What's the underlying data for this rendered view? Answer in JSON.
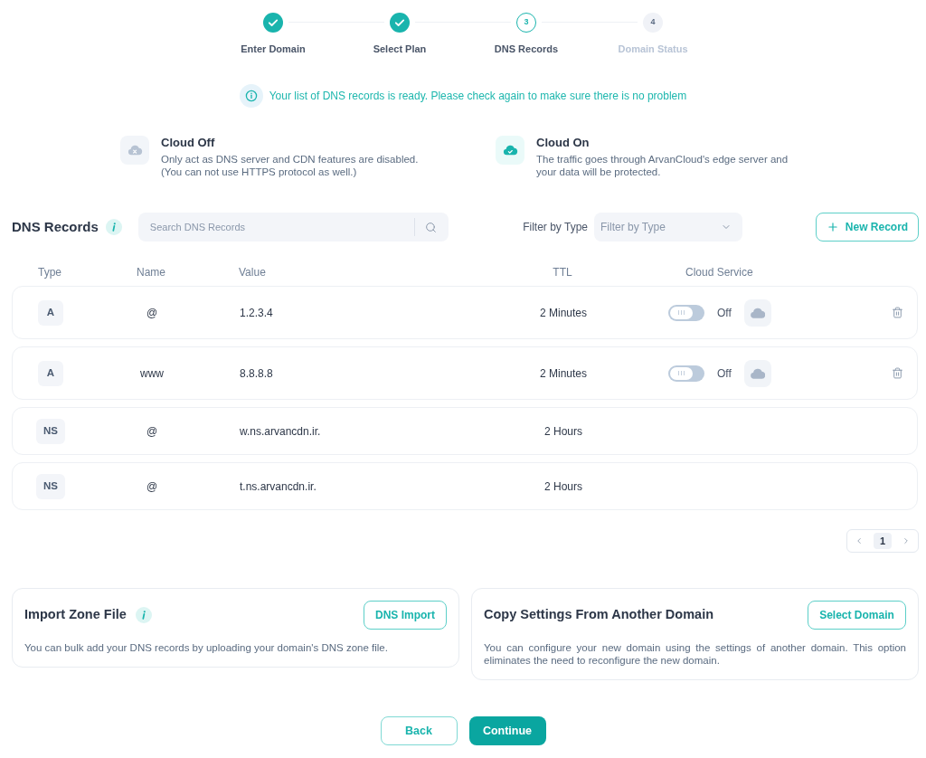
{
  "stepper": {
    "steps": [
      {
        "label": "Enter Domain",
        "completed": true,
        "selected": false
      },
      {
        "label": "Select Plan",
        "completed": true,
        "selected": false
      },
      {
        "number": "3",
        "label": "DNS Records",
        "completed": false,
        "selected": true
      },
      {
        "number": "4",
        "label": "Domain Status",
        "completed": false,
        "selected": false
      }
    ]
  },
  "notice": {
    "text": "Your list of DNS records is ready. Please check again to make sure there is no problem"
  },
  "cloud_modes": [
    {
      "kind": "off",
      "title": "Cloud Off",
      "description": "Only act as DNS server and CDN features are disabled.\n(You can not use HTTPS protocol as well.)"
    },
    {
      "kind": "on",
      "title": "Cloud On",
      "description": "The traffic goes through ArvanCloud's edge server and\nyour data will be protected."
    }
  ],
  "records": {
    "title": "DNS Records",
    "search": {
      "placeholder": "Search DNS Records"
    },
    "filter": {
      "label": "Filter by Type",
      "placeholder": "Filter by Type"
    },
    "new_button": "New Record"
  },
  "table": {
    "columns": [
      "Type",
      "Name",
      "Value",
      "TTL",
      "Cloud Service"
    ],
    "rows": [
      {
        "type": "A",
        "name": "@",
        "value": "1.2.3.4",
        "ttl": "2 Minutes",
        "cloud": {
          "on": false,
          "status": "Off"
        },
        "deletable": true
      },
      {
        "type": "A",
        "name": "www",
        "value": "8.8.8.8",
        "ttl": "2 Minutes",
        "cloud": {
          "on": false,
          "status": "Off"
        },
        "deletable": true
      },
      {
        "type": "NS",
        "name": "@",
        "value": "w.ns.arvancdn.ir.",
        "ttl": "2 Hours",
        "deletable": false
      },
      {
        "type": "NS",
        "name": "@",
        "value": "t.ns.arvancdn.ir.",
        "ttl": "2 Hours",
        "deletable": false
      }
    ]
  },
  "pagination": {
    "pages": [
      {
        "label": "1",
        "selected": true
      }
    ]
  },
  "import_card": {
    "title": "Import Zone File",
    "button": "DNS Import",
    "description": "You can bulk add your DNS records by uploading your domain's DNS zone file."
  },
  "copy_card": {
    "title": "Copy Settings From Another Domain",
    "button": "Select Domain",
    "description": "You can configure your new domain using the settings of another domain. This option eliminates the need to reconfigure the new domain."
  },
  "actions": {
    "back": "Back",
    "continue": "Continue"
  }
}
